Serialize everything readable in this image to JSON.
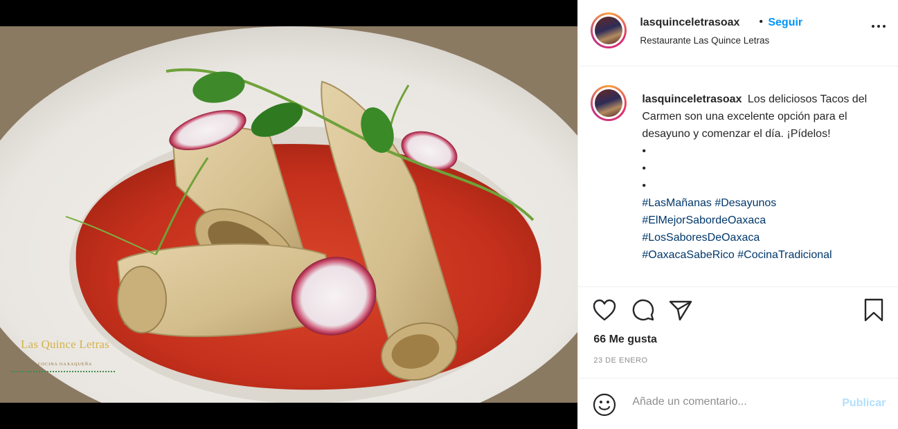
{
  "post": {
    "username": "lasquinceletrasoax",
    "separator": "•",
    "follow_label": "Seguir",
    "location": "Restaurante Las Quince Letras",
    "avatar_icon": "profile-avatar-icon",
    "more_icon": "more-options-icon"
  },
  "media": {
    "watermark_name": "Las Quince Letras",
    "watermark_sub": "COCINA OAXAQUEÑA"
  },
  "caption": {
    "username": "lasquinceletrasoax",
    "text": "Los deliciosos Tacos del Carmen son una excelente opción para el desayuno y comenzar el día. ¡Pídelos!",
    "dots": [
      "•",
      "•",
      "•"
    ],
    "hashtags": [
      "#LasMañanas",
      "#Desayunos",
      "#ElMejorSabordeOaxaca",
      "#LosSaboresDeOaxaca",
      "#OaxacaSabeRico",
      "#CocinaTradicional"
    ]
  },
  "actions": {
    "icons": [
      "heart-icon",
      "comment-icon",
      "share-icon",
      "bookmark-icon"
    ],
    "likes": "66 Me gusta",
    "date": "23 DE ENERO"
  },
  "comment": {
    "placeholder": "Añade un comentario...",
    "publish_label": "Publicar"
  },
  "colors": {
    "accent": "#0095f6",
    "publish_disabled": "#b2dffc",
    "hashtag": "#00376b"
  }
}
